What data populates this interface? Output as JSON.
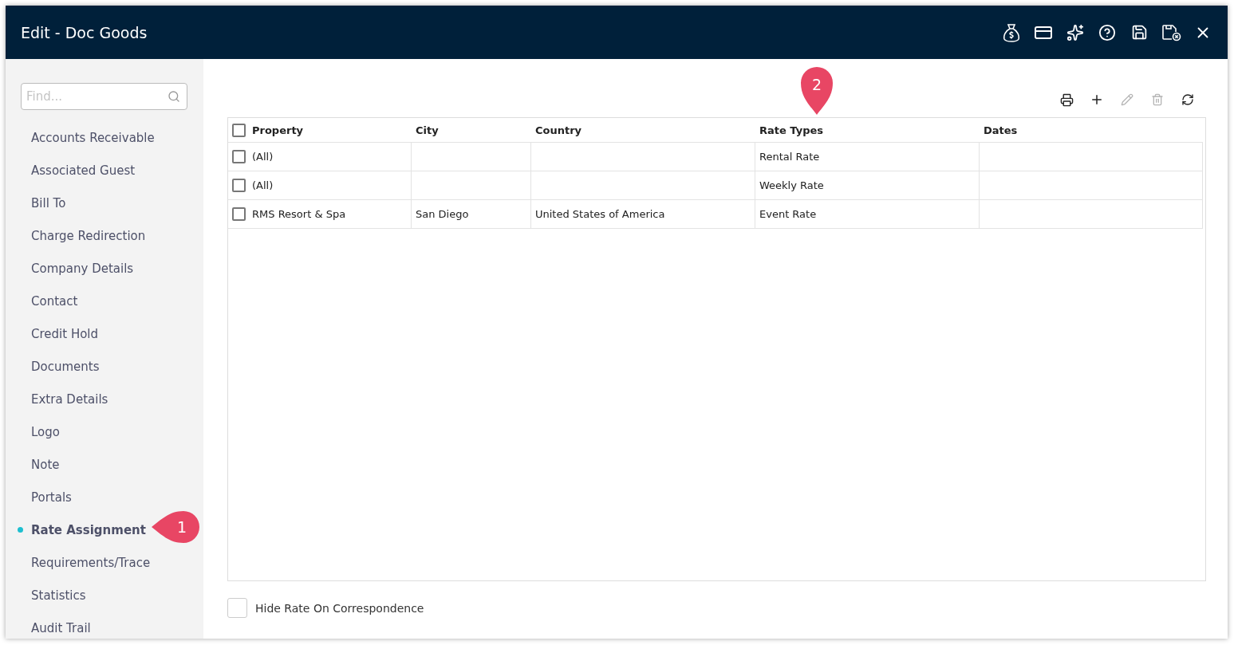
{
  "window": {
    "title": "Edit - Doc Goods"
  },
  "sidebar": {
    "search": {
      "placeholder": "Find..."
    },
    "items": [
      {
        "label": "Accounts Receivable",
        "selected": false
      },
      {
        "label": "Associated Guest",
        "selected": false
      },
      {
        "label": "Bill To",
        "selected": false
      },
      {
        "label": "Charge Redirection",
        "selected": false
      },
      {
        "label": "Company Details",
        "selected": false
      },
      {
        "label": "Contact",
        "selected": false
      },
      {
        "label": "Credit Hold",
        "selected": false
      },
      {
        "label": "Documents",
        "selected": false
      },
      {
        "label": "Extra Details",
        "selected": false
      },
      {
        "label": "Logo",
        "selected": false
      },
      {
        "label": "Note",
        "selected": false
      },
      {
        "label": "Portals",
        "selected": false
      },
      {
        "label": "Rate Assignment",
        "selected": true
      },
      {
        "label": "Requirements/Trace",
        "selected": false
      },
      {
        "label": "Statistics",
        "selected": false
      },
      {
        "label": "Audit Trail",
        "selected": false
      }
    ]
  },
  "toolbar": [
    {
      "kind": "print",
      "disabled": false
    },
    {
      "kind": "add",
      "disabled": false
    },
    {
      "kind": "edit",
      "disabled": true
    },
    {
      "kind": "delete",
      "disabled": true
    },
    {
      "kind": "refresh",
      "disabled": false
    }
  ],
  "table": {
    "all_checked": false,
    "columns": [
      "Property",
      "City",
      "Country",
      "Rate Types",
      "Dates"
    ],
    "rows": [
      {
        "checked": false,
        "cells": [
          "(All)",
          "",
          "",
          "Rental Rate",
          ""
        ]
      },
      {
        "checked": false,
        "cells": [
          "(All)",
          "",
          "",
          "Weekly Rate",
          ""
        ]
      },
      {
        "checked": false,
        "cells": [
          "RMS Resort & Spa",
          "San Diego",
          "United States of America",
          "Event Rate",
          ""
        ]
      }
    ]
  },
  "hide_rate": {
    "label": "Hide Rate On Correspondence",
    "checked": false
  },
  "callouts": [
    {
      "label": "1",
      "kind": "left"
    },
    {
      "label": "2",
      "kind": "down"
    }
  ]
}
